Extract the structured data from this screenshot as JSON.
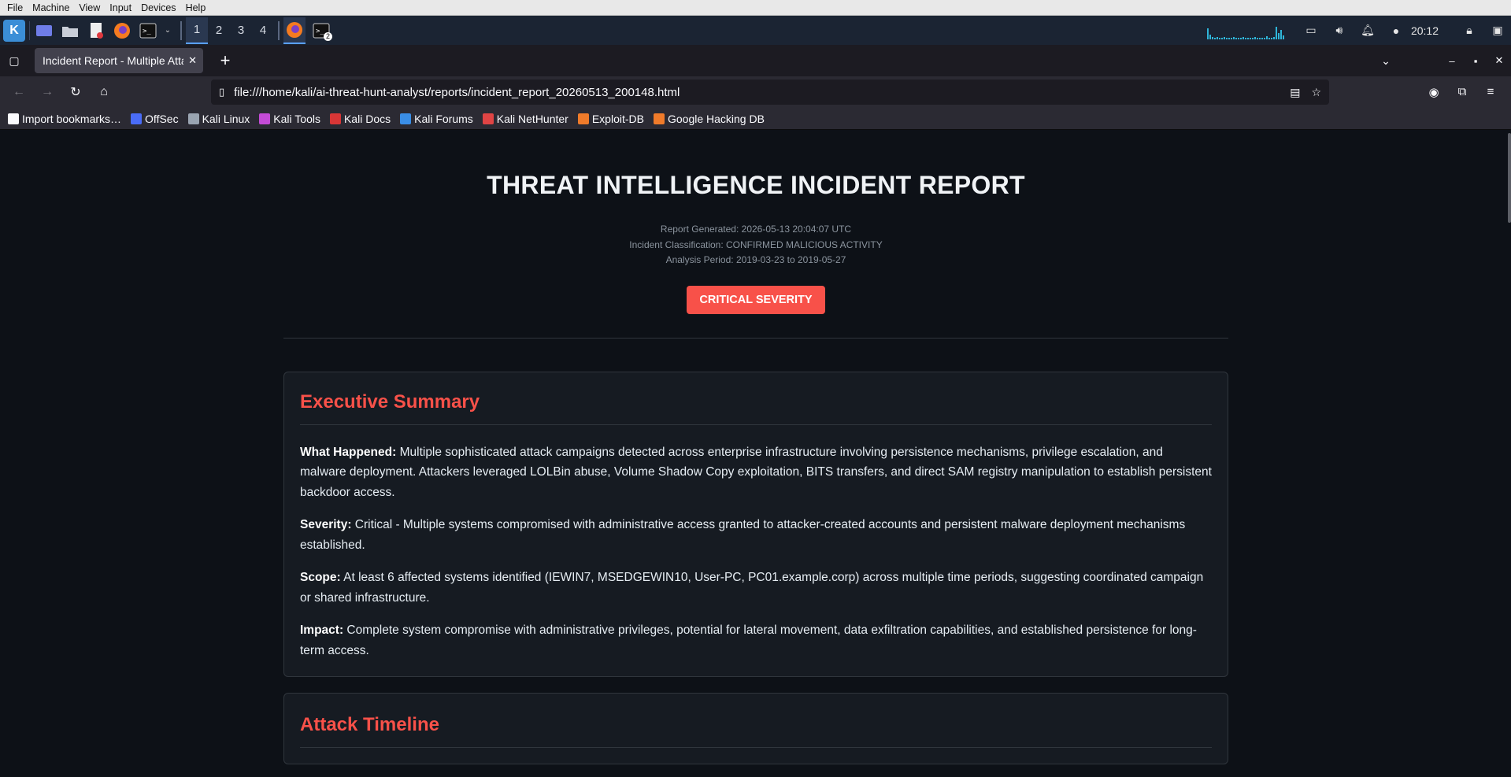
{
  "vm_menu": [
    "File",
    "Machine",
    "View",
    "Input",
    "Devices",
    "Help"
  ],
  "taskbar": {
    "workspaces": [
      "1",
      "2",
      "3",
      "4"
    ],
    "terminal_badge": "2",
    "clock": "20:12"
  },
  "browser": {
    "tab_title": "Incident Report - Multiple Attack Campaigns",
    "url": "file:///home/kali/ai-threat-hunt-analyst/reports/incident_report_20260513_200148.html",
    "bookmarks": [
      {
        "label": "Import bookmarks…",
        "icon": "import-icon",
        "color": "#fbfbfe"
      },
      {
        "label": "OffSec",
        "icon": "offsec-icon",
        "color": "#4a6cf7"
      },
      {
        "label": "Kali Linux",
        "icon": "kali-icon",
        "color": "#9aa4b1"
      },
      {
        "label": "Kali Tools",
        "icon": "kali-tools-icon",
        "color": "#c44bd6"
      },
      {
        "label": "Kali Docs",
        "icon": "kali-docs-icon",
        "color": "#d93636"
      },
      {
        "label": "Kali Forums",
        "icon": "kali-forums-icon",
        "color": "#3a8ee6"
      },
      {
        "label": "Kali NetHunter",
        "icon": "nethunter-icon",
        "color": "#e04444"
      },
      {
        "label": "Exploit-DB",
        "icon": "exploitdb-icon",
        "color": "#f07b2a"
      },
      {
        "label": "Google Hacking DB",
        "icon": "ghdb-icon",
        "color": "#f07b2a"
      }
    ]
  },
  "report": {
    "title": "THREAT INTELLIGENCE INCIDENT REPORT",
    "generated": "Report Generated: 2026-05-13 20:04:07 UTC",
    "classification": "Incident Classification: CONFIRMED MALICIOUS ACTIVITY",
    "period": "Analysis Period: 2019-03-23 to 2019-05-27",
    "severity_badge": "CRITICAL SEVERITY",
    "severity_color": "#f85149",
    "executive_summary": {
      "heading": "Executive Summary",
      "what_label": "What Happened:",
      "what_text": " Multiple sophisticated attack campaigns detected across enterprise infrastructure involving persistence mechanisms, privilege escalation, and malware deployment. Attackers leveraged LOLBin abuse, Volume Shadow Copy exploitation, BITS transfers, and direct SAM registry manipulation to establish persistent backdoor access.",
      "severity_label": "Severity:",
      "severity_text": " Critical - Multiple systems compromised with administrative access granted to attacker-created accounts and persistent malware deployment mechanisms established.",
      "scope_label": "Scope:",
      "scope_text": " At least 6 affected systems identified (IEWIN7, MSEDGEWIN10, User-PC, PC01.example.corp) across multiple time periods, suggesting coordinated campaign or shared infrastructure.",
      "impact_label": "Impact:",
      "impact_text": " Complete system compromise with administrative privileges, potential for lateral movement, data exfiltration capabilities, and established persistence for long-term access."
    },
    "attack_timeline": {
      "heading": "Attack Timeline"
    }
  }
}
